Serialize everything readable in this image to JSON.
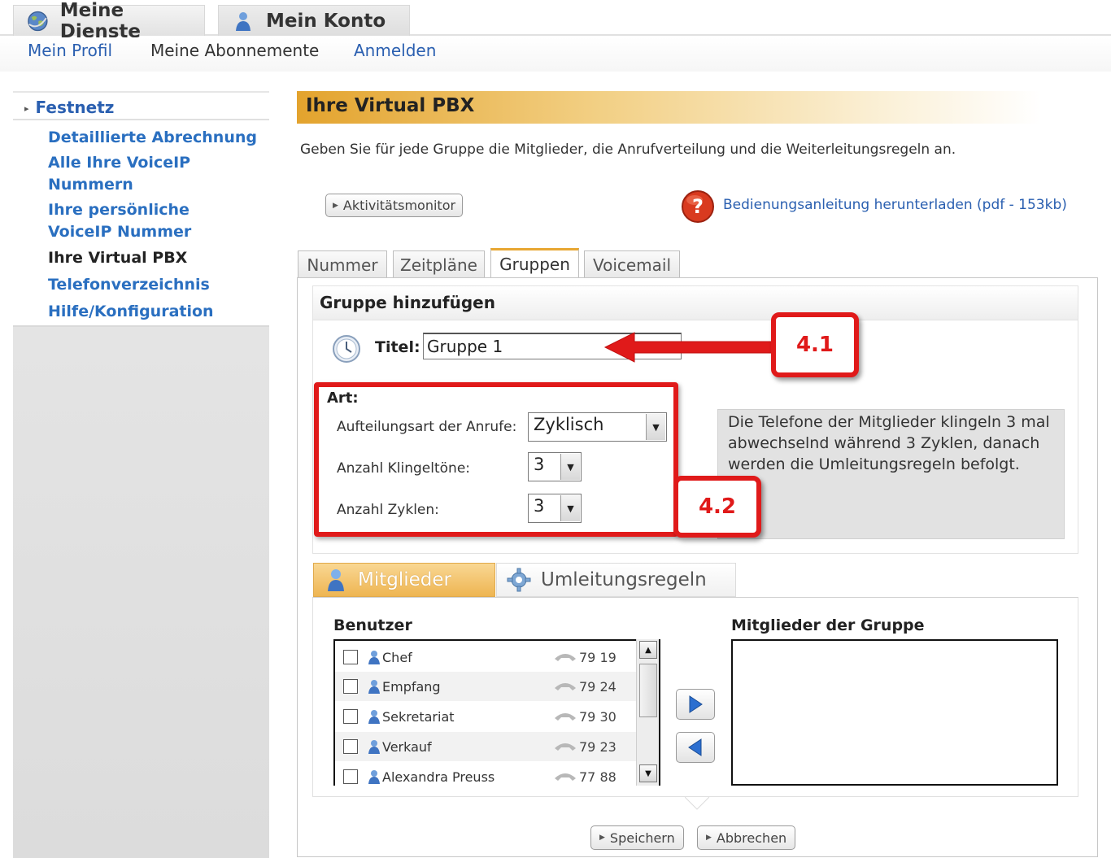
{
  "top_tabs": {
    "services": "Meine Dienste",
    "account": "Mein Konto"
  },
  "subnav": {
    "profile": "Mein Profil",
    "subscriptions": "Meine Abonnemente",
    "login": "Anmelden"
  },
  "sidebar": {
    "section": "Festnetz",
    "items": [
      {
        "label": "Detaillierte Abrechnung",
        "active": false
      },
      {
        "label": "Alle Ihre VoiceIP Nummern",
        "active": false
      },
      {
        "label": "Ihre persönliche VoiceIP Nummer",
        "active": false
      },
      {
        "label": "Ihre Virtual PBX",
        "active": true
      },
      {
        "label": "Telefonverzeichnis",
        "active": false
      },
      {
        "label": "Hilfe/Konfiguration",
        "active": false
      }
    ]
  },
  "page": {
    "title": "Ihre Virtual PBX",
    "intro": "Geben Sie für jede Gruppe die Mitglieder, die Anrufverteilung und die Weiterleitungsregeln an.",
    "activity_button": "Aktivitätsmonitor",
    "manual_link": "Bedienungsanleitung herunterladen (pdf - 153kb)"
  },
  "tabs": [
    "Nummer",
    "Zeitpläne",
    "Gruppen",
    "Voicemail"
  ],
  "active_tab": "Gruppen",
  "form": {
    "heading": "Gruppe hinzufügen",
    "title_label": "Titel:",
    "title_value": "Gruppe 1",
    "art_label": "Art:",
    "distribution_label": "Aufteilungsart der Anrufe:",
    "distribution_value": "Zyklisch",
    "rings_label": "Anzahl Klingeltöne:",
    "rings_value": "3",
    "cycles_label": "Anzahl Zyklen:",
    "cycles_value": "3",
    "info_text": "Die Telefone der Mitglieder klingeln 3 mal abwechselnd während 3 Zyklen, danach werden die Umleitungsregeln befolgt."
  },
  "callouts": {
    "first": "4.1",
    "second": "4.2"
  },
  "member_tabs": {
    "members": "Mitglieder",
    "rules": "Umleitungsregeln"
  },
  "users_heading": "Benutzer",
  "group_members_heading": "Mitglieder der Gruppe",
  "users": [
    {
      "name": "Chef",
      "ext": "79 19"
    },
    {
      "name": "Empfang",
      "ext": "79 24"
    },
    {
      "name": "Sekretariat",
      "ext": "79 30"
    },
    {
      "name": "Verkauf",
      "ext": "79 23"
    },
    {
      "name": "Alexandra Preuss",
      "ext": "77 88"
    }
  ],
  "footer": {
    "save": "Speichern",
    "cancel": "Abbrechen"
  },
  "colors": {
    "accent_orange": "#e8a733",
    "link_blue": "#2a5fb0",
    "callout_red": "#e01a1a"
  }
}
